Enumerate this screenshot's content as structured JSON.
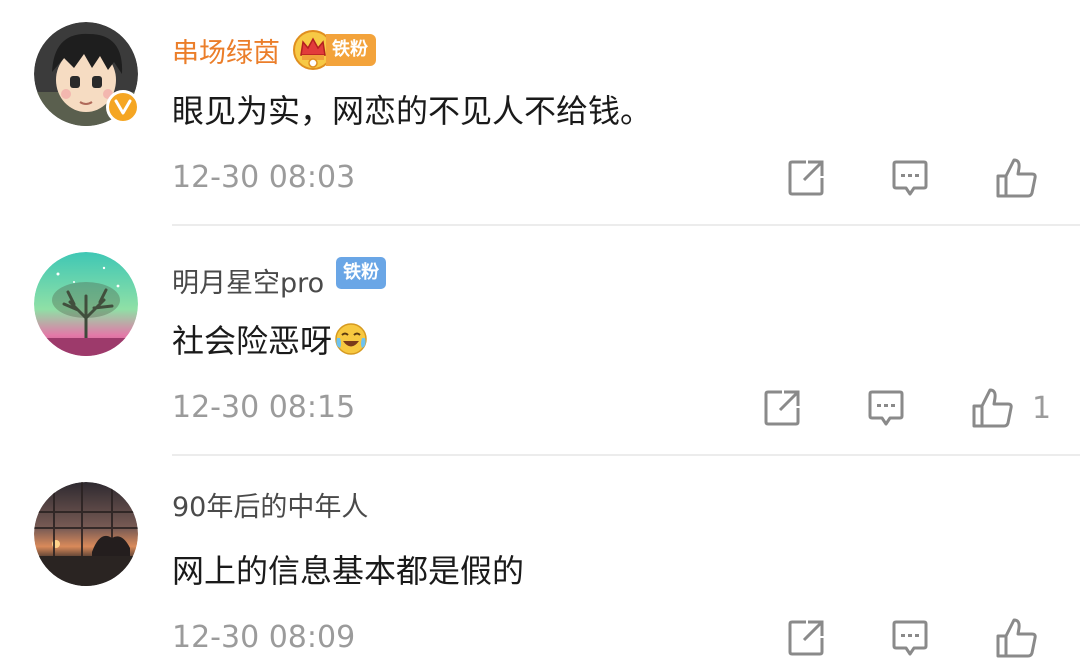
{
  "comments": [
    {
      "username": "串场绿茵",
      "badge": "铁粉",
      "text": "眼见为实，网恋的不见人不给钱。",
      "time": "12-30 08:03",
      "likes": ""
    },
    {
      "username": "明月星空pro",
      "badge": "铁粉",
      "text": "社会险恶呀",
      "time": "12-30 08:15",
      "likes": "1"
    },
    {
      "username": "90年后的中年人",
      "text": "网上的信息基本都是假的",
      "time": "12-30 08:09",
      "likes": ""
    }
  ],
  "colors": {
    "vip_name": "#eb7e2a",
    "normal_name": "#4a4a4a",
    "meta": "#9b9b9b",
    "crown_badge": "#f3a33b",
    "fan_badge": "#6aa6e6",
    "verified": "#f5a623"
  },
  "icons": {
    "share": "share-icon",
    "reply": "comment-icon",
    "like": "thumbs-up-icon",
    "crown": "crown-icon",
    "verified": "verified-icon",
    "emoji": "laugh-cry-emoji-icon"
  }
}
